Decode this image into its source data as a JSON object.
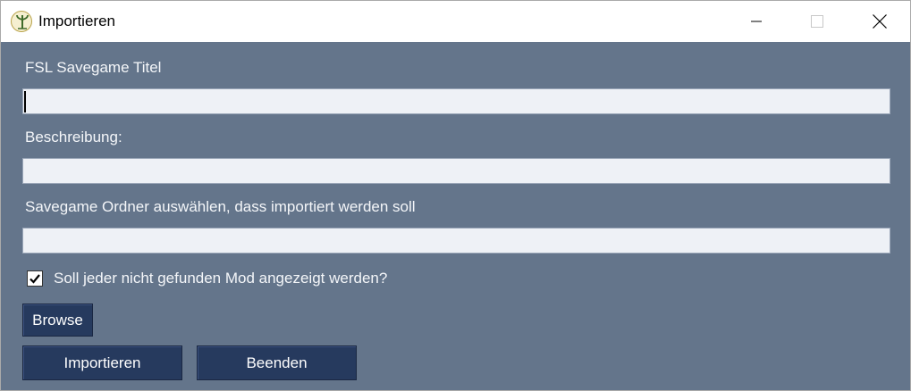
{
  "window": {
    "title": "Importieren",
    "icon": "fsl-app-icon",
    "controls": [
      "minimize-icon",
      "maximize-icon",
      "close-icon"
    ]
  },
  "form": {
    "title_label": "FSL Savegame Titel",
    "title_value": "",
    "description_label": "Beschreibung:",
    "description_value": "",
    "folder_label": "Savegame Ordner auswählen, dass importiert werden soll",
    "folder_value": "",
    "checkbox_label": "Soll jeder nicht gefunden Mod angezeigt werden?",
    "checkbox_checked": true
  },
  "buttons": {
    "browse": "Browse",
    "import": "Importieren",
    "quit": "Beenden"
  },
  "colors": {
    "background": "#64758b",
    "button": "#263a5e",
    "field": "#eef1f6",
    "text": "#f4f6f9"
  }
}
